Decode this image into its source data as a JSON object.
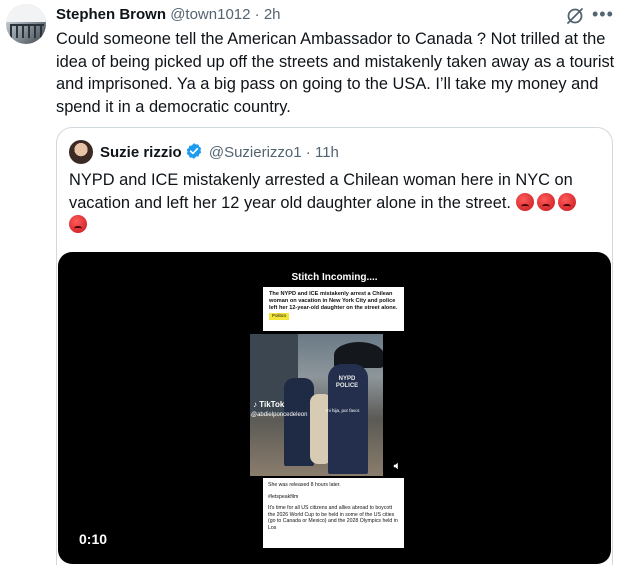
{
  "post": {
    "author_name": "Stephen Brown",
    "author_handle": "@town1012",
    "separator": "·",
    "time": "2h",
    "text": "Could someone tell the American Ambassador to Canada ? Not trilled at the idea of being picked up off the streets and mistakenly taken away as a tourist and imprisoned. Ya a big pass on going to the USA. I’ll take my money and spend it in a democratic country.",
    "more_icon": "more-horizontal-icon",
    "grok_icon": "grok-icon"
  },
  "quote": {
    "author_name": "Suzie rizzio",
    "author_handle": "@Suzierizzo1",
    "separator": "·",
    "time": "11h",
    "verified_color": "#1d9bf0",
    "text": "NYPD and ICE mistakenly arrested a Chilean woman here in NYC on vacation and left her 12 year old daughter alone in the street.",
    "emoji_name": "angry-face-emoji",
    "emoji_count": 4
  },
  "video": {
    "title": "Stitch Incoming....",
    "headline": "The NYPD and ICE mistakenly arrest a Chilean woman on vacation in New York City and police left her 12-year-old daughter on the street alone.",
    "tag": "Politics",
    "uniform_label": "NYPD POLICE",
    "tiktok_label": "TikTok",
    "tiktok_handle": "@abdielponcedeleon",
    "overlay_caption": "mi hija, por favor.",
    "bottom_line1": "She was released 8 hours later.",
    "bottom_line2": "#letspeakfilm",
    "bottom_line3": "It's time for all US citizens and allies abroad to boycott the 2026 World Cup to be held in some of the US cities (go to Canada or Mexico) and the 2028 Olympics held in Los",
    "timecode": "0:10"
  }
}
